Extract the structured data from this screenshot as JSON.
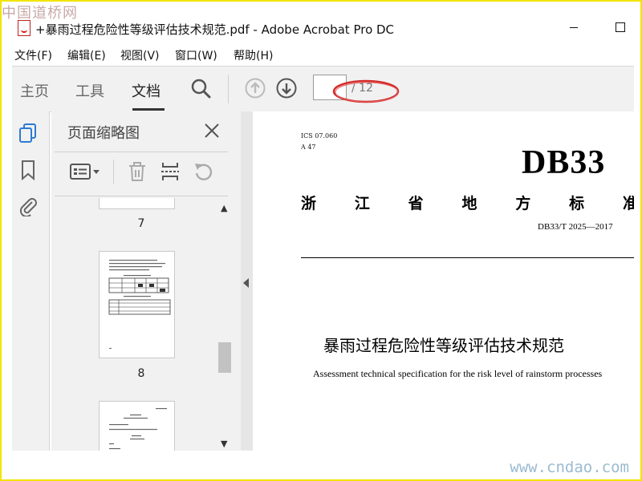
{
  "watermark": {
    "top": "中国道桥网",
    "bottom": "www.cndao.com"
  },
  "window": {
    "title": "+暴雨过程危险性等级评估技术规范.pdf - Adobe Acrobat Pro DC"
  },
  "menu": [
    "文件(F)",
    "编辑(E)",
    "视图(V)",
    "窗口(W)",
    "帮助(H)"
  ],
  "toolbar": {
    "tabs": [
      "主页",
      "工具",
      "文档"
    ],
    "active_tab": "文档",
    "page_input_value": "",
    "page_total": "/ 12",
    "icons": [
      "search-icon",
      "previous-page-icon",
      "next-page-icon"
    ],
    "highlight_color": "#d42a2a"
  },
  "left_rail": {
    "icons": [
      "page-thumbnails-icon",
      "bookmark-icon",
      "attachment-icon"
    ],
    "accent": "#2d7bd1"
  },
  "thumbnail_panel": {
    "title": "页面缩略图",
    "tools": [
      "page-options-icon",
      "delete-page-icon",
      "insert-page-icon",
      "rotate-page-icon"
    ],
    "pages": [
      {
        "number": "7"
      },
      {
        "number": "8"
      }
    ]
  },
  "document": {
    "ics": "ICS 07.060",
    "class_code": "A 47",
    "db_code": "DB33",
    "standard_type_chars": [
      "浙",
      "江",
      "省",
      "地",
      "方",
      "标",
      "准"
    ],
    "standard_number": "DB33/T 2025—2017",
    "title_cn": "暴雨过程危险性等级评估技术规范",
    "title_en": "Assessment technical specification for the risk level of rainstorm processes"
  }
}
